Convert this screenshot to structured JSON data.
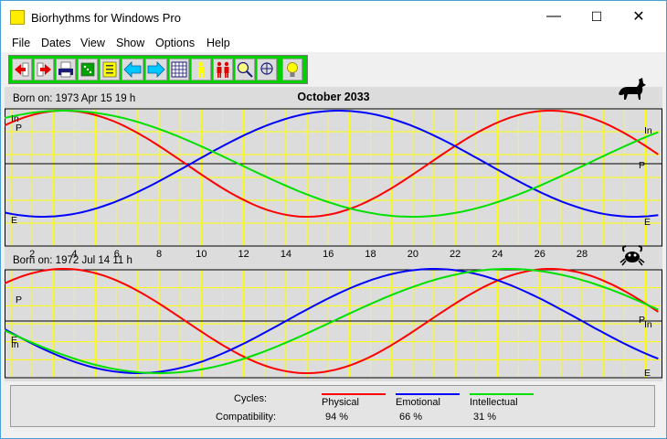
{
  "window": {
    "title": "Biorhythms for Windows Pro",
    "minimize": "—",
    "maximize": "☐",
    "close": "✕"
  },
  "menu": [
    "File",
    "Dates",
    "View",
    "Show",
    "Options",
    "Help"
  ],
  "toolbar": {
    "buttons": [
      {
        "icon": "arrow-left-red-icon"
      },
      {
        "icon": "arrow-right-red-icon"
      },
      {
        "icon": "print-icon"
      },
      {
        "icon": "dice-icon"
      },
      {
        "icon": "calendar-list-icon"
      },
      {
        "icon": "arrow-left-blue-icon"
      },
      {
        "icon": "arrow-right-blue-icon"
      },
      {
        "icon": "calendar-grid-icon"
      },
      {
        "icon": "person-icon"
      },
      {
        "icon": "couple-icon"
      },
      {
        "icon": "zoom-in-icon"
      },
      {
        "icon": "zoom-out-icon"
      },
      {
        "icon": "lightbulb-icon"
      }
    ]
  },
  "chart": {
    "month_title": "October 2033",
    "day_labels": [
      "2",
      "4",
      "6",
      "8",
      "10",
      "12",
      "14",
      "16",
      "18",
      "20",
      "22",
      "24",
      "26",
      "28"
    ],
    "person1": {
      "born": "Born on: 1973 Apr 15  19 h",
      "zodiac_icon": "sagittarius-centaur-icon",
      "left_labels": [
        "In",
        "P",
        "E"
      ],
      "right_labels": [
        "In",
        "P",
        "E"
      ]
    },
    "person2": {
      "born": "Born on: 1972 Jul 14  11 h",
      "zodiac_icon": "cancer-crab-icon",
      "left_labels": [
        "P",
        "E",
        "In"
      ],
      "right_labels": [
        "P",
        "In",
        "E"
      ]
    }
  },
  "colors": {
    "physical": "#ff0000",
    "emotional": "#0000ff",
    "intellectual": "#00e000",
    "grid": "#ffff00",
    "panel_bg": "#dcdcdc"
  },
  "chart_data": {
    "type": "line",
    "title": "October 2033",
    "x": "days 1–31 of October 2033",
    "xticks": [
      2,
      4,
      6,
      8,
      10,
      12,
      14,
      16,
      18,
      20,
      22,
      24,
      26,
      28
    ],
    "ylim": [
      -1,
      1
    ],
    "grid": true,
    "person1": {
      "peaks": {
        "physical": 26.5,
        "emotional": 16.5,
        "intellectual": 3.5
      },
      "series": [
        {
          "name": "Physical",
          "period": 23
        },
        {
          "name": "Emotional",
          "period": 28
        },
        {
          "name": "Intellectual",
          "period": 33
        }
      ]
    },
    "person2": {
      "peaks": {
        "physical": 3.5,
        "emotional": 21.0,
        "intellectual": 24.5
      },
      "series": [
        {
          "name": "Physical",
          "period": 23
        },
        {
          "name": "Emotional",
          "period": 28
        },
        {
          "name": "Intellectual",
          "period": 33
        }
      ]
    }
  },
  "compatibility": {
    "cycles_label": "Cycles:",
    "compat_label": "Compatibility:",
    "items": [
      {
        "name": "Physical",
        "value": "94  %"
      },
      {
        "name": "Emotional",
        "value": "66  %"
      },
      {
        "name": "Intellectual",
        "value": "31  %"
      }
    ]
  }
}
